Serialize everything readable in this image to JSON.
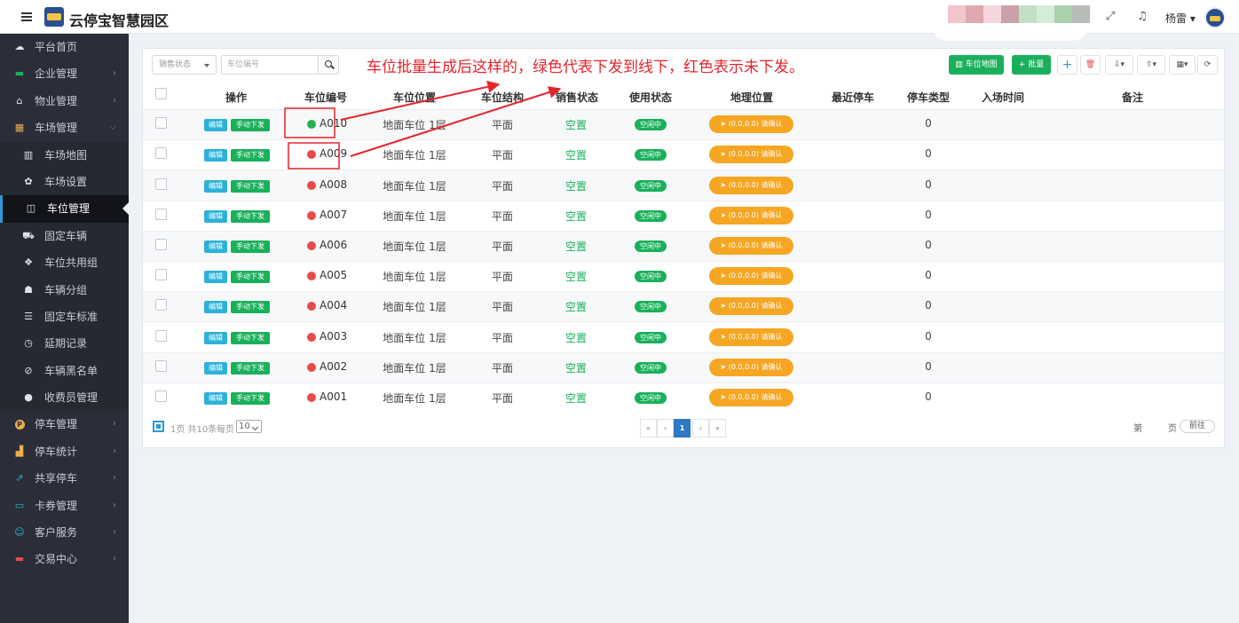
{
  "app": {
    "title": "云停宝智慧园区",
    "user": "杨雷"
  },
  "sidebar": {
    "items": [
      {
        "label": "平台首页",
        "icon": "cloud-icon",
        "glyph": "☁",
        "type": "top",
        "arrow": false
      },
      {
        "label": "企业管理",
        "icon": "briefcase-icon",
        "glyph": "▬",
        "type": "top",
        "arrow": true
      },
      {
        "label": "物业管理",
        "icon": "home-icon",
        "glyph": "⌂",
        "type": "top",
        "arrow": true
      },
      {
        "label": "车场管理",
        "icon": "windows-icon",
        "glyph": "▦",
        "type": "top",
        "arrow": true,
        "open": true
      },
      {
        "label": "车场地图",
        "icon": "map-icon",
        "glyph": "▥",
        "type": "sub"
      },
      {
        "label": "车场设置",
        "icon": "gear-icon",
        "glyph": "✿",
        "type": "sub"
      },
      {
        "label": "车位管理",
        "icon": "columns-icon",
        "glyph": "◫",
        "type": "active"
      },
      {
        "label": "固定车辆",
        "icon": "car-icon",
        "glyph": "⛟",
        "type": "sub"
      },
      {
        "label": "车位共用组",
        "icon": "cubes-icon",
        "glyph": "❖",
        "type": "sub"
      },
      {
        "label": "车辆分组",
        "icon": "users-icon",
        "glyph": "☗",
        "type": "sub"
      },
      {
        "label": "固定车标准",
        "icon": "list-icon",
        "glyph": "☰",
        "type": "sub"
      },
      {
        "label": "延期记录",
        "icon": "clock-icon",
        "glyph": "◷",
        "type": "sub"
      },
      {
        "label": "车辆黑名单",
        "icon": "ban-icon",
        "glyph": "⊘",
        "type": "sub"
      },
      {
        "label": "收费员管理",
        "icon": "user-icon",
        "glyph": "●",
        "type": "sub"
      },
      {
        "label": "停车管理",
        "icon": "parking-icon",
        "glyph": "P",
        "type": "top",
        "arrow": true
      },
      {
        "label": "停车统计",
        "icon": "bar-chart-icon",
        "glyph": "▟",
        "type": "top",
        "arrow": true
      },
      {
        "label": "共享停车",
        "icon": "share-icon",
        "glyph": "⇗",
        "type": "top",
        "arrow": true
      },
      {
        "label": "卡券管理",
        "icon": "card-icon",
        "glyph": "▭",
        "type": "top",
        "arrow": true
      },
      {
        "label": "客户服务",
        "icon": "smile-icon",
        "glyph": "☺",
        "type": "top",
        "arrow": true
      },
      {
        "label": "交易中心",
        "icon": "visa-icon",
        "glyph": "▬",
        "type": "top",
        "arrow": true
      }
    ]
  },
  "toolbar": {
    "sale_status_placeholder": "销售状态",
    "space_code_placeholder": "车位编号",
    "map_button": "车位地图",
    "batch_button": "批量"
  },
  "annotation": "车位批量生成后这样的，绿色代表下发到线下，红色表示未下发。",
  "table": {
    "headers": [
      "操作",
      "车位编号",
      "车位位置",
      "车位结构",
      "销售状态",
      "使用状态",
      "地理位置",
      "最近停车",
      "停车类型",
      "入场时间",
      "备注"
    ],
    "edit_label": "编辑",
    "push_label": "手动下发",
    "rows": [
      {
        "code": "A010",
        "issued": true,
        "location": "地面车位  1层",
        "structure": "平面",
        "sale": "空置",
        "usage": "空闲中",
        "geo": "(0.0,0.0) 请确认",
        "parking_type": "0"
      },
      {
        "code": "A009",
        "issued": false,
        "location": "地面车位  1层",
        "structure": "平面",
        "sale": "空置",
        "usage": "空闲中",
        "geo": "(0.0,0.0) 请确认",
        "parking_type": "0"
      },
      {
        "code": "A008",
        "issued": false,
        "location": "地面车位  1层",
        "structure": "平面",
        "sale": "空置",
        "usage": "空闲中",
        "geo": "(0.0,0.0) 请确认",
        "parking_type": "0"
      },
      {
        "code": "A007",
        "issued": false,
        "location": "地面车位  1层",
        "structure": "平面",
        "sale": "空置",
        "usage": "空闲中",
        "geo": "(0.0,0.0) 请确认",
        "parking_type": "0"
      },
      {
        "code": "A006",
        "issued": false,
        "location": "地面车位  1层",
        "structure": "平面",
        "sale": "空置",
        "usage": "空闲中",
        "geo": "(0.0,0.0) 请确认",
        "parking_type": "0"
      },
      {
        "code": "A005",
        "issued": false,
        "location": "地面车位  1层",
        "structure": "平面",
        "sale": "空置",
        "usage": "空闲中",
        "geo": "(0.0,0.0) 请确认",
        "parking_type": "0"
      },
      {
        "code": "A004",
        "issued": false,
        "location": "地面车位  1层",
        "structure": "平面",
        "sale": "空置",
        "usage": "空闲中",
        "geo": "(0.0,0.0) 请确认",
        "parking_type": "0"
      },
      {
        "code": "A003",
        "issued": false,
        "location": "地面车位  1层",
        "structure": "平面",
        "sale": "空置",
        "usage": "空闲中",
        "geo": "(0.0,0.0) 请确认",
        "parking_type": "0"
      },
      {
        "code": "A002",
        "issued": false,
        "location": "地面车位  1层",
        "structure": "平面",
        "sale": "空置",
        "usage": "空闲中",
        "geo": "(0.0,0.0) 请确认",
        "parking_type": "0"
      },
      {
        "code": "A001",
        "issued": false,
        "location": "地面车位  1层",
        "structure": "平面",
        "sale": "空置",
        "usage": "空闲中",
        "geo": "(0.0,0.0) 请确认",
        "parking_type": "0"
      }
    ]
  },
  "pagination": {
    "info": "1页 共10条",
    "per_page_label": "每页",
    "page_size": "10",
    "first": "«",
    "prev": "‹",
    "current": "1",
    "next": "›",
    "last": "»",
    "jump_prefix": "第",
    "jump_suffix": "页",
    "go_label": "前往"
  },
  "colors": {
    "issued": "#27b04b",
    "not_issued": "#e84a4a",
    "accent_green": "#1ab05b",
    "accent_blue": "#2eb1d9",
    "geo_orange": "#f5a623",
    "annotation_red": "#e5242b",
    "sidebar_bg": "#2b2e38",
    "blur_swatches": [
      "#f2c4cc",
      "#dfa8b0",
      "#f4d6dc",
      "#c8a2a8",
      "#c3e0c7",
      "#d5ecd7",
      "#a9d1ad",
      "#b8bcb8"
    ]
  }
}
